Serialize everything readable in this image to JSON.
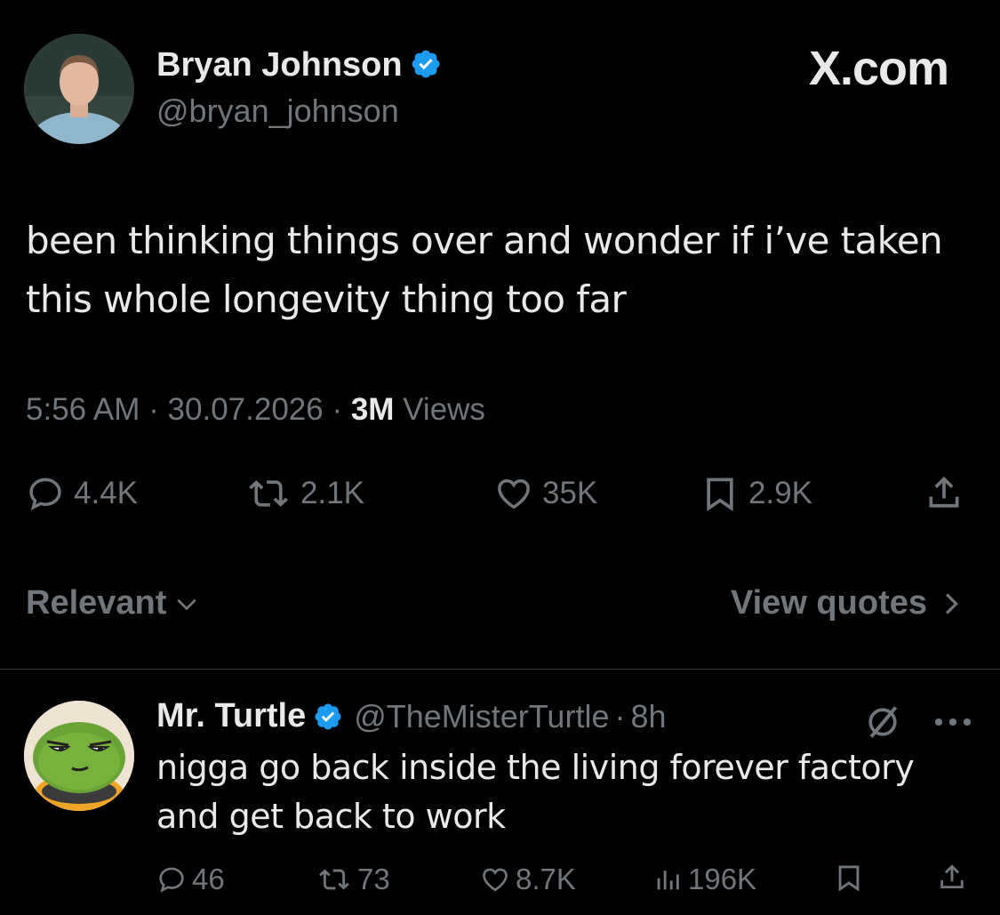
{
  "tweet": {
    "author": {
      "name": "Bryan Johnson",
      "handle": "@bryan_johnson",
      "avatar_icon": "profile-photo"
    },
    "brand": "X.com",
    "text": "been thinking things over and wonder if i’ve taken this whole longevity thing too far",
    "time": "5:56 AM",
    "date": "30.07.2026",
    "views_count": "3M",
    "views_label": "Views",
    "separator": "·",
    "stats": {
      "replies": "4.4K",
      "reposts": "2.1K",
      "likes": "35K",
      "bookmarks": "2.9K"
    }
  },
  "replies_bar": {
    "sort_label": "Relevant",
    "view_quotes_label": "View quotes"
  },
  "reply": {
    "name": "Mr. Turtle",
    "handle": "@TheMisterTurtle",
    "time": "8h",
    "separator": "·",
    "text": "nigga go back inside the living forever factory and get back to work",
    "stats": {
      "replies": "46",
      "reposts": "73",
      "likes": "8.7K",
      "views": "196K"
    }
  },
  "colors": {
    "background": "#000000",
    "text_primary": "#e7e9ea",
    "text_secondary": "#71767b",
    "verified": "#1d9bf0",
    "divider": "#2f3336"
  }
}
